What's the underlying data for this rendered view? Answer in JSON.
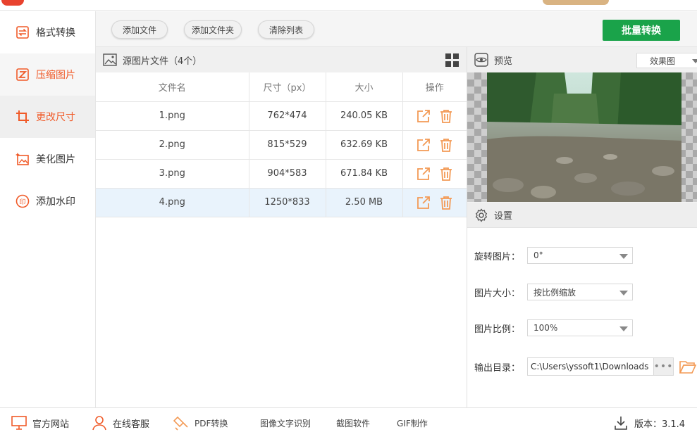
{
  "sidebar": {
    "items": [
      {
        "label": "格式转换",
        "icon": "convert-arrows-icon"
      },
      {
        "label": "压缩图片",
        "icon": "compress-icon"
      },
      {
        "label": "更改尺寸",
        "icon": "crop-resize-icon"
      },
      {
        "label": "美化图片",
        "icon": "beautify-image-icon"
      },
      {
        "label": "添加水印",
        "icon": "watermark-stamp-icon"
      }
    ],
    "active_index": 2
  },
  "toolbar": {
    "add_file": "添加文件",
    "add_folder": "添加文件夹",
    "clear_list": "清除列表",
    "batch_convert": "批量转换"
  },
  "file_panel": {
    "title": "源图片文件（4个）",
    "columns": [
      "文件名",
      "尺寸（px）",
      "大小",
      "操作"
    ],
    "rows": [
      {
        "name": "1.png",
        "dimensions": "762*474",
        "size": "240.05 KB"
      },
      {
        "name": "2.png",
        "dimensions": "815*529",
        "size": "632.69 KB"
      },
      {
        "name": "3.png",
        "dimensions": "904*583",
        "size": "671.84 KB"
      },
      {
        "name": "4.png",
        "dimensions": "1250*833",
        "size": "2.50 MB"
      }
    ],
    "selected_row": 3
  },
  "preview": {
    "label": "预览",
    "view_mode": "效果图"
  },
  "settings": {
    "label": "设置",
    "rotate_label": "旋转图片：",
    "rotate_value": "0°",
    "size_label": "图片大小：",
    "size_value": "按比例缩放",
    "ratio_label": "图片比例：",
    "ratio_value": "100%",
    "output_label": "输出目录：",
    "output_path": "C:\\Users\\yssoft1\\Downloads",
    "browse_dots": "•••"
  },
  "bottom_bar": {
    "website": "官方网站",
    "support": "在线客服",
    "pdf": "PDF转换",
    "ocr": "图像文字识别",
    "screenshot": "截图软件",
    "gif": "GIF制作",
    "version": "版本：3.1.4"
  },
  "colors": {
    "accent_orange": "#f05a28",
    "convert_green": "#1aa34a",
    "selected_row": "#e9f3fc"
  }
}
